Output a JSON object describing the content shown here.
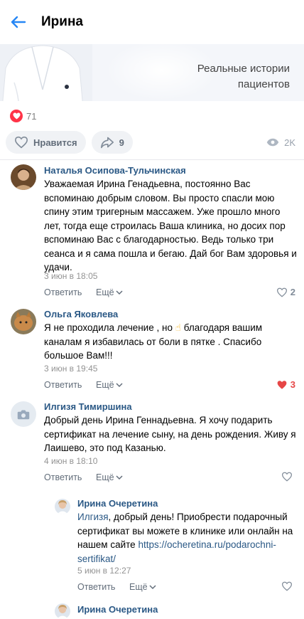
{
  "header": {
    "title": "Ирина"
  },
  "banner": {
    "line1": "Реальные истории",
    "line2": "пациентов"
  },
  "post": {
    "likes": "71",
    "like_button": "Нравится",
    "shares": "9",
    "views": "2K"
  },
  "comments": [
    {
      "author": "Наталья Осипова-Тульчинская",
      "text": "Уважаемая Ирина Генадьевна, постоянно Вас вспоминаю добрым словом. Вы просто спасли мою спину этим тригерным массажем. Уже прошло много лет, тогда еще строилась Ваша клиника, но досих пор вспоминаю Вас с благодарностью. Ведь только три сеанса и я сама пошла и бегаю. Дай бог Вам здоровья и удачи.",
      "date": "3 июн в 18:05",
      "reply": "Ответить",
      "more": "Ещё",
      "likes": "2"
    },
    {
      "author": "Ольга Яковлева",
      "text_before": "Я не проходила лечение , но",
      "emoji": "☝",
      "text_after": "благодаря вашим каналам я избавилась от боли в пятке . Спасибо большое Вам!!!",
      "date": "3 июн в 19:45",
      "reply": "Ответить",
      "more": "Ещё",
      "likes": "3"
    },
    {
      "author": "Илгизя Тимиршина",
      "text": "Добрый день Ирина Геннадьевна. Я хочу подарить сертификат на лечение сыну, на день рождения. Живу я Лаишево, это под Казанью.",
      "date": "4 июн в 18:10",
      "reply": "Ответить",
      "more": "Ещё"
    },
    {
      "author": "Ирина Очеретина",
      "mention": "Илгизя",
      "text": ", добрый день! Приобрести подарочный сертификат вы можете в клинике или онлайн на нашем сайте",
      "link": "https://ocheretina.ru/podarochni-sertifikat/",
      "date": "5 июн в 12:27",
      "reply": "Ответить",
      "more": "Ещё"
    },
    {
      "author": "Ирина Очеретина"
    }
  ],
  "colors": {
    "accent": "#2a5885",
    "like_red": "#e64646",
    "badge_red": "#ff3347",
    "back_blue": "#2787f5"
  }
}
